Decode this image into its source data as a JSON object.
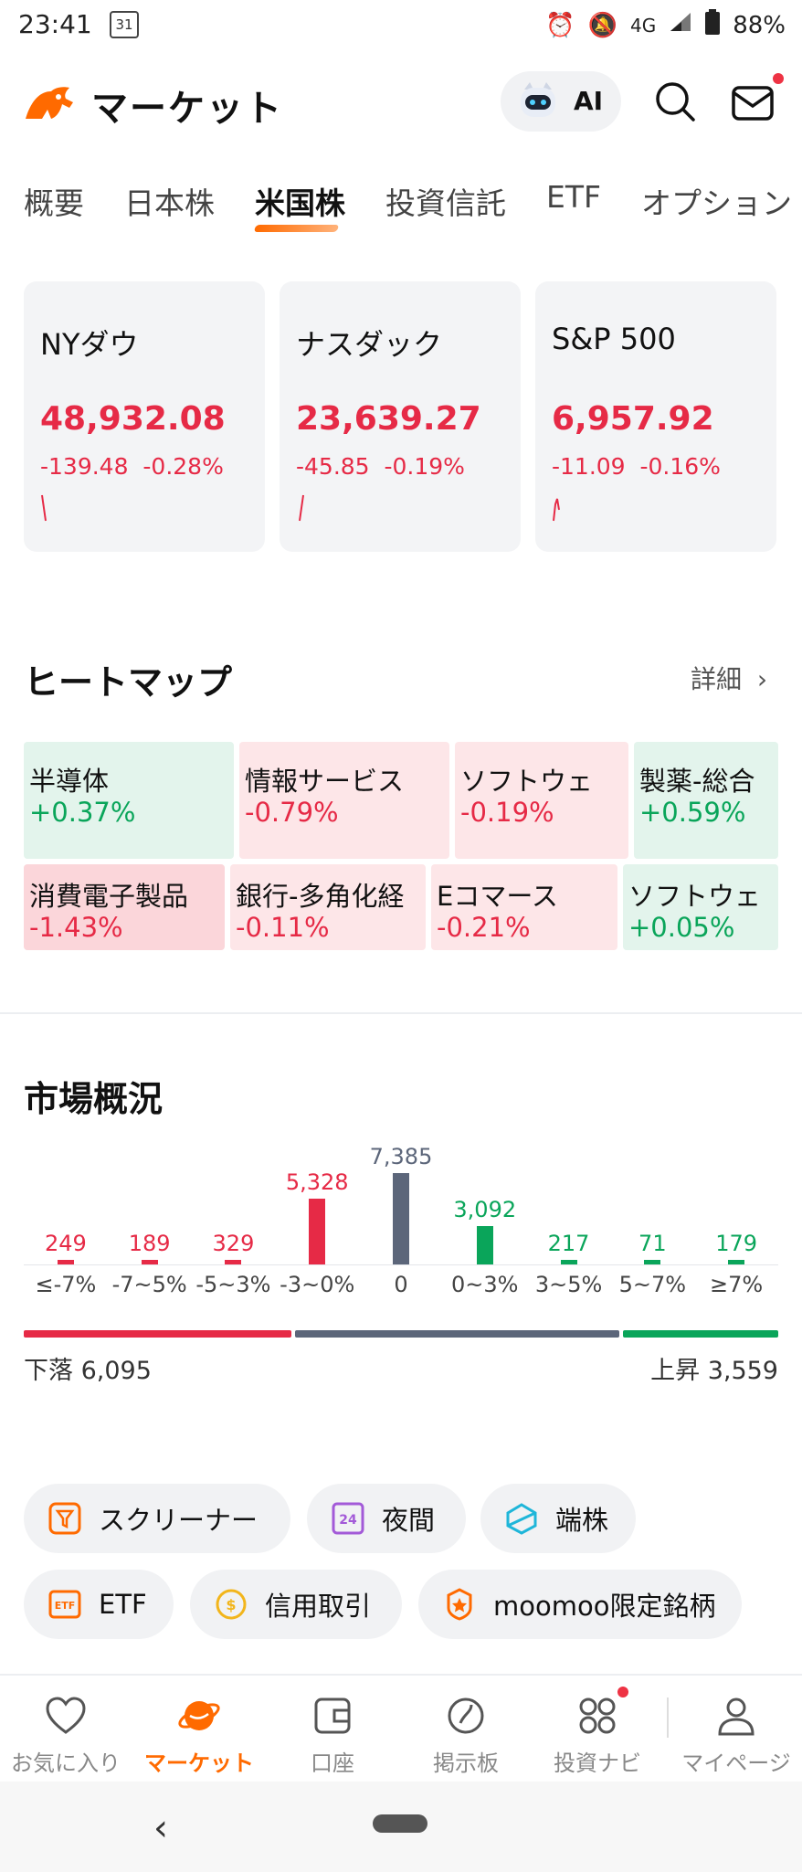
{
  "status": {
    "time": "23:41",
    "calendar": "31",
    "network": "4G",
    "battery": "88%"
  },
  "header": {
    "title": "マーケット",
    "ai_label": "AI"
  },
  "tabs": [
    "概要",
    "日本株",
    "米国株",
    "投資信託",
    "ETF",
    "オプション"
  ],
  "active_tab": "米国株",
  "indices": [
    {
      "name": "NYダウ",
      "price": "48,932.08",
      "change": "-139.48",
      "pct": "-0.28%"
    },
    {
      "name": "ナスダック",
      "price": "23,639.27",
      "change": "-45.85",
      "pct": "-0.19%"
    },
    {
      "name": "S&P 500",
      "price": "6,957.92",
      "change": "-11.09",
      "pct": "-0.16%"
    }
  ],
  "heatmap": {
    "title": "ヒートマップ",
    "detail": "詳細",
    "row1": [
      {
        "name": "半導体",
        "value": "+0.37%"
      },
      {
        "name": "情報サービス",
        "value": "-0.79%"
      },
      {
        "name": "ソフトウェ",
        "value": "-0.19%"
      },
      {
        "name": "製薬-総合",
        "value": "+0.59%"
      }
    ],
    "row2": [
      {
        "name": "消費電子製品",
        "value": "-1.43%"
      },
      {
        "name": "銀行-多角化経",
        "value": "-0.11%"
      },
      {
        "name": "Eコマース",
        "value": "-0.21%"
      },
      {
        "name": "ソフトウェ",
        "value": "+0.05%"
      }
    ]
  },
  "market_overview": {
    "title": "市場概況",
    "down_label": "下落 6,095",
    "up_label": "上昇 3,559"
  },
  "chart_data": {
    "type": "bar",
    "categories": [
      "≤-7%",
      "-7~5%",
      "-5~3%",
      "-3~0%",
      "0",
      "0~3%",
      "3~5%",
      "5~7%",
      "≥7%"
    ],
    "values": [
      249,
      189,
      329,
      5328,
      7385,
      3092,
      217,
      71,
      179
    ],
    "value_labels": [
      "249",
      "189",
      "329",
      "5,328",
      "7,385",
      "3,092",
      "217",
      "71",
      "179"
    ],
    "colors": [
      "#e62a46",
      "#e62a46",
      "#e62a46",
      "#e62a46",
      "#5c667a",
      "#0aa55a",
      "#0aa55a",
      "#0aa55a",
      "#0aa55a"
    ],
    "ratio": {
      "down": 6095,
      "flat": 7385,
      "up": 3559
    }
  },
  "chips_row1": [
    "スクリーナー",
    "夜間",
    "端株"
  ],
  "chips_row2": [
    "ETF",
    "信用取引",
    "moomoo限定銘柄"
  ],
  "nav": [
    "お気に入り",
    "マーケット",
    "口座",
    "掲示板",
    "投資ナビ",
    "マイページ"
  ],
  "colors": {
    "accent": "#ff6a00",
    "down": "#e62a46",
    "up": "#0aa55a",
    "flat": "#5c667a"
  }
}
